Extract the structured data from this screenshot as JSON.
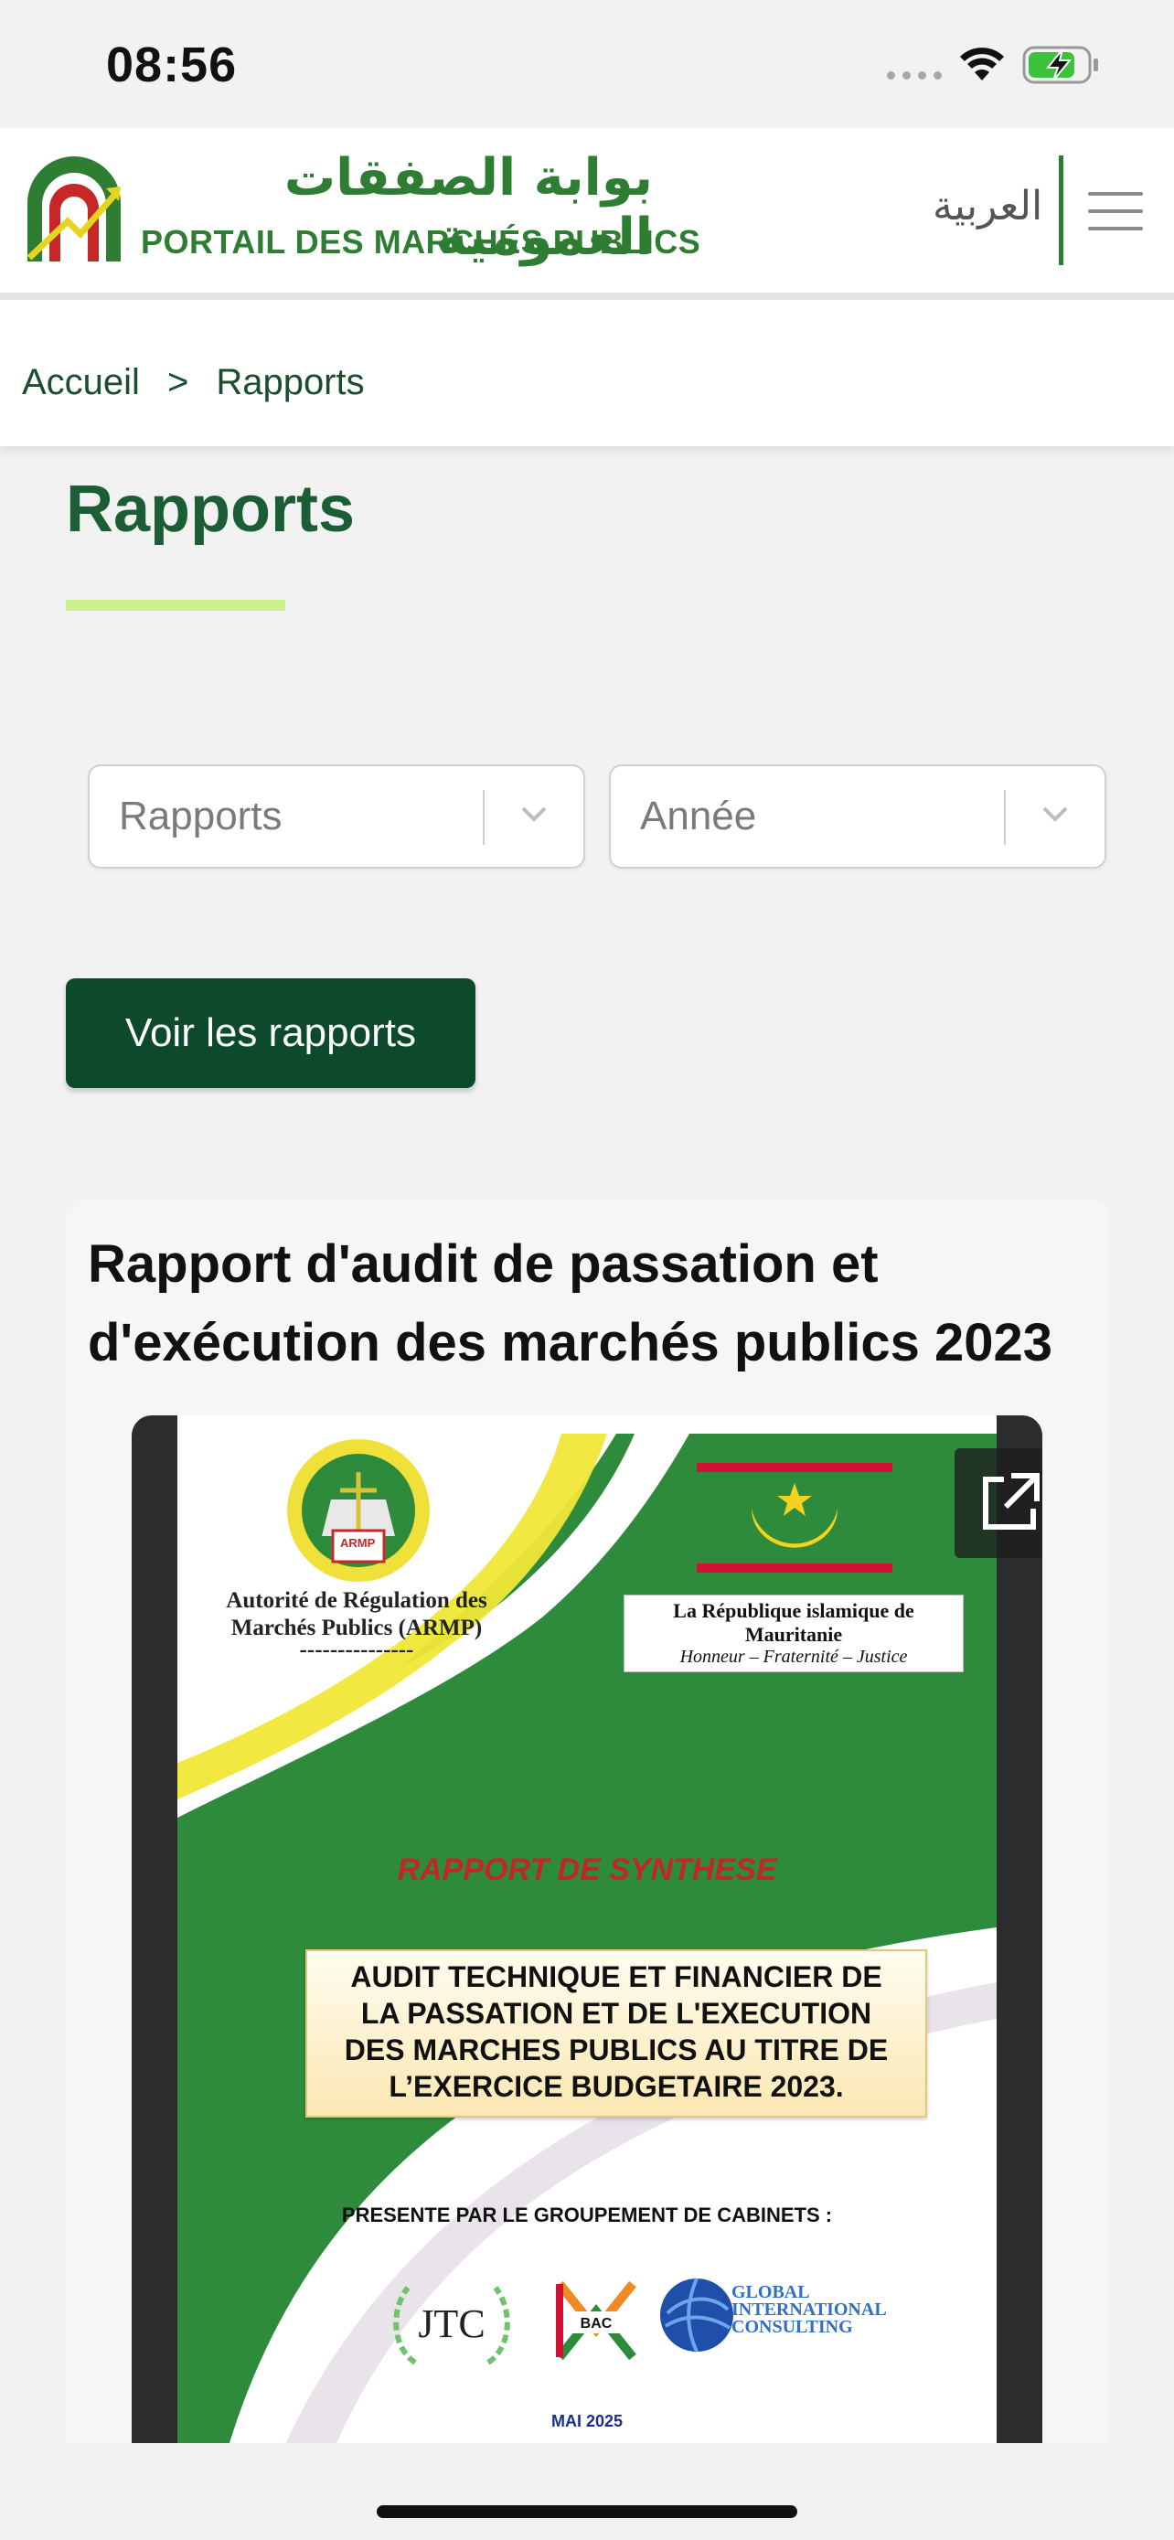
{
  "status_bar": {
    "time": "08:56"
  },
  "header": {
    "logo_ar": "بوابة الصفقات العمومية",
    "logo_fr": "PORTAIL DES MARCHÉS PUBLICS",
    "lang_switch": "العربية"
  },
  "breadcrumb": {
    "home": "Accueil",
    "separator": ">",
    "current": "Rapports"
  },
  "main": {
    "title": "Rapports",
    "filters": {
      "type_placeholder": "Rapports",
      "year_placeholder": "Année"
    },
    "submit_label": "Voir les rapports"
  },
  "report_card": {
    "title": "Rapport d'audit de passation et d'exécution des marchés publics 2023",
    "document": {
      "org_line1": "Autorité de Régulation des",
      "org_line2": "Marchés Publics (ARMP)",
      "org_dash": "---------------",
      "armp_badge": "ARMP",
      "republic": "La République islamique de Mauritanie",
      "motto": "Honneur – Fraternité – Justice",
      "synthesis": "RAPPORT DE SYNTHESE",
      "box_line1": "AUDIT TECHNIQUE ET FINANCIER DE",
      "box_line2": "LA PASSATION ET DE L'EXECUTION",
      "box_line3": "DES MARCHES PUBLICS AU TITRE DE",
      "box_line4": "L’EXERCICE BUDGETAIRE 2023.",
      "presented_by": "PRESENTE PAR LE GROUPEMENT DE CABINETS :",
      "firm1": "JTC",
      "firm2": "BAC",
      "firm3_line1": "GLOBAL",
      "firm3_line2": "INTERNATIONAL",
      "firm3_line3": "CONSULTING",
      "date": "MAI 2025"
    }
  },
  "colors": {
    "brand_green": "#2e7d32",
    "button_green": "#0c4a2b",
    "accent_lime": "#ccf08c"
  },
  "icons": {
    "wifi": "wifi-icon",
    "battery": "battery-charging-icon",
    "menu": "hamburger-menu-icon",
    "chevron": "chevron-down-icon",
    "open_external": "open-in-new-icon"
  }
}
